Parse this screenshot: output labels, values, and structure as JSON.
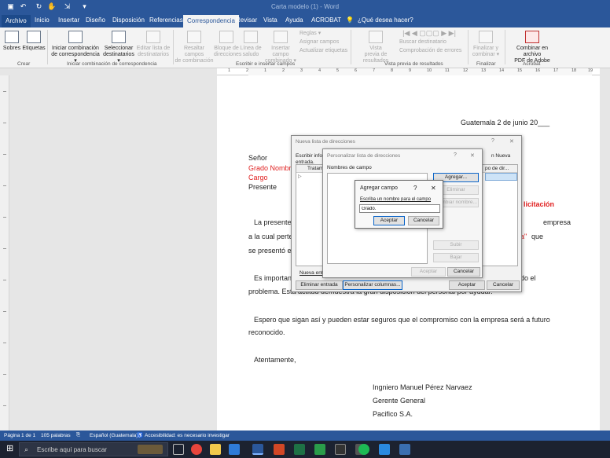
{
  "window": {
    "title": "Carta modelo (1) - Word"
  },
  "tabs": [
    "Archivo",
    "Inicio",
    "Insertar",
    "Diseño",
    "Disposición",
    "Referencias",
    "Correspondencia",
    "Revisar",
    "Vista",
    "Ayuda",
    "ACROBAT",
    "¿Qué desea hacer?"
  ],
  "ribbon": {
    "sobres": "Sobres",
    "etiquetas": "Etiquetas",
    "crear": "Crear",
    "iniciar1": "Iniciar combinación",
    "iniciar2": "de correspondencia ▾",
    "seleccionar1": "Seleccionar",
    "seleccionar2": "destinatarios ▾",
    "editar1": "Editar lista de",
    "editar2": "destinatarios",
    "grupo_iniciar": "Iniciar combinación de correspondencia",
    "resaltar1": "Resaltar campos",
    "resaltar2": "de combinación",
    "bloque1": "Bloque de",
    "bloque2": "direcciones",
    "linea1": "Línea de",
    "linea2": "saludo",
    "insertar1": "Insertar campo",
    "insertar2": "combinado ▾",
    "reglas": "Reglas ▾",
    "asignar": "Asignar campos",
    "actualizar": "Actualizar etiquetas",
    "grupo_escribir": "Escribir e insertar campos",
    "vista1": "Vista",
    "vista2": "previa de resultados",
    "buscar": "Buscar destinatario",
    "comprobar": "Comprobación de errores",
    "grupo_vista": "Vista previa de resultados",
    "finalizar1": "Finalizar y",
    "finalizar2": "combinar ▾",
    "grupo_finalizar": "Finalizar",
    "adobe1": "Combinar en archivo",
    "adobe2": "PDF de Adobe",
    "grupo_acrobat": "Acrobat"
  },
  "ruler": [
    "1",
    "2",
    "1",
    "2",
    "3",
    "4",
    "5",
    "6",
    "7",
    "8",
    "9",
    "10",
    "11",
    "12",
    "13",
    "14",
    "15",
    "16",
    "17",
    "18",
    "19"
  ],
  "document": {
    "fecha": "Guatemala 2 de junio 20___",
    "senor": "Señor",
    "grado": "Grado Nombre",
    "cargo": "Cargo",
    "presente": "Presente",
    "titulo_frag": "licitación",
    "p1a": "La presente t",
    "p1a_end": "empresa",
    "p1b": "a la cual perter",
    "p1b_red": "a\"",
    "p1b_end": "que",
    "p1c": "se presentó el",
    "p2a": "Es important",
    "p2a_end": "do el",
    "p2b": "problema. Esta actitud demuestra la gran disposición del personal por ayudar.",
    "p3a": "Espero que sigan así y pueden estar seguros que el compromiso con la empresa será a futuro",
    "p3b": "reconocido.",
    "atentamente": "Atentamente,",
    "firma1": "Ingniero Manuel Pérez Narvaez",
    "firma2": "Gerente General",
    "firma3": "Pacifico S.A."
  },
  "dlg_nueva": {
    "title": "Nueva lista de direcciones",
    "instr1": "Escribir infor",
    "instr2": "entrada.",
    "col_tratamiento": "Tratamie",
    "col_right": "n Nueva",
    "col_dir": "po de dir...",
    "nueva_entrada": "Nueva ent",
    "eliminar": "Eliminar entrada",
    "personalizar": "Personalizar columnas...",
    "aceptar": "Aceptar",
    "cancelar": "Cancelar"
  },
  "dlg_personalizar": {
    "title": "Personalizar lista de direcciones",
    "q": "?",
    "close": "✕",
    "nombres": "Nombres de campo",
    "agregar": "Agregar...",
    "eliminar": "Eliminar",
    "cambiar": "Cambiar nombre...",
    "subir": "Subir",
    "bajar": "Bajar",
    "aceptar": "Aceptar",
    "cancelar": "Cancelar"
  },
  "dlg_agregar": {
    "title": "Agregar campo",
    "q": "?",
    "close": "✕",
    "label": "Escriba un nombre para el campo",
    "value": "Grado.",
    "aceptar": "Aceptar",
    "cancelar": "Cancelar"
  },
  "status": {
    "pagina": "Página 1 de 1",
    "palabras": "105 palabras",
    "idioma": "Español (Guatemala)",
    "accesibilidad": "Accesibilidad: es necesario investigar"
  },
  "taskbar": {
    "search_placeholder": "Escribe aquí para buscar"
  }
}
